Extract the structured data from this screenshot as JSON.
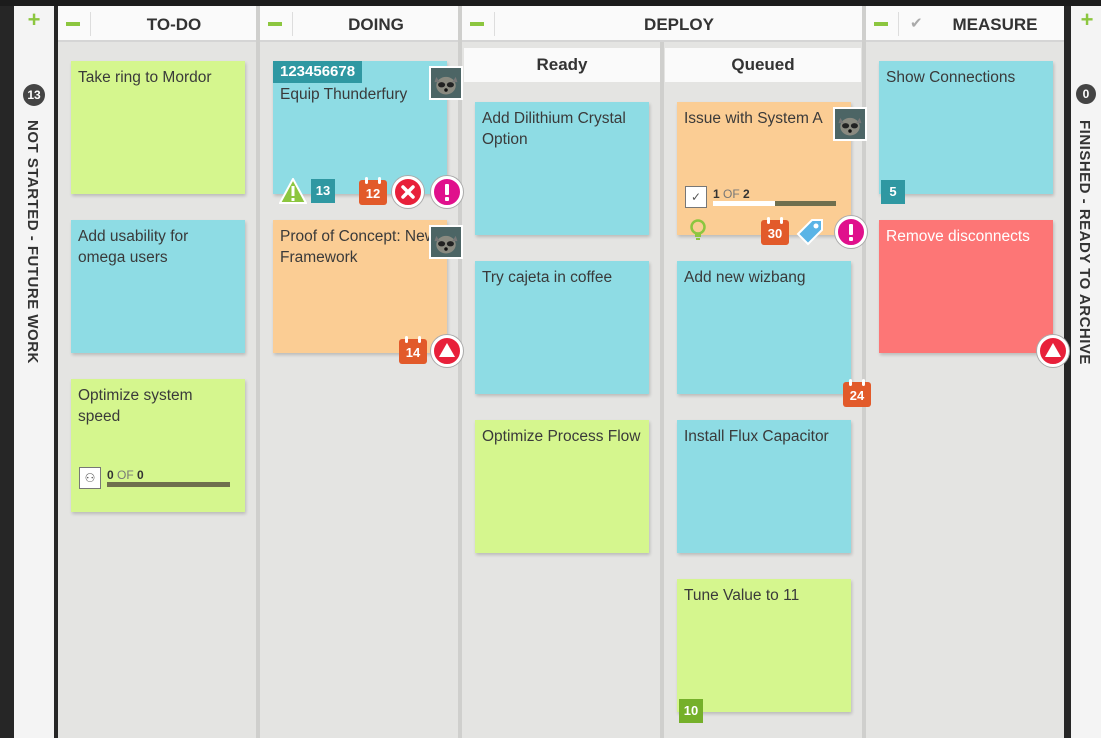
{
  "side_left": {
    "count": "13",
    "label": "NOT STARTED - FUTURE WORK"
  },
  "side_right": {
    "count": "0",
    "label": "FINISHED - READY TO ARCHIVE"
  },
  "columns": {
    "todo": {
      "title": "TO-DO"
    },
    "doing": {
      "title": "DOING"
    },
    "deploy": {
      "title": "DEPLOY",
      "sub_ready": "Ready",
      "sub_queued": "Queued"
    },
    "measure": {
      "title": "MEASURE"
    }
  },
  "cards": {
    "todo_1": {
      "title": "Take ring to Mordor",
      "color": "#d5f68e"
    },
    "todo_2": {
      "title": "Add usability for omega users",
      "color": "#8edce4"
    },
    "todo_3": {
      "title": "Optimize system speed",
      "color": "#d5f68e",
      "progress_done": "0",
      "progress_of": "OF",
      "progress_total": "0",
      "progress_fraction": 0
    },
    "doing_1": {
      "id": "123456678",
      "title": "Equip Thunderfury",
      "color": "#8edce4",
      "count": "13",
      "due": "12"
    },
    "doing_2": {
      "title": "Proof of Concept: New Framework",
      "color": "#fbcd94",
      "due": "14"
    },
    "ready_1": {
      "title": "Add Dilithium Crystal Option",
      "color": "#8edce4"
    },
    "ready_2": {
      "title": "Try cajeta in coffee",
      "color": "#8edce4"
    },
    "ready_3": {
      "title": "Optimize Process Flow",
      "color": "#d5f68e"
    },
    "queued_1": {
      "title": "Issue with System A",
      "color": "#fbcd94",
      "progress_done": "1",
      "progress_of": "OF",
      "progress_total": "2",
      "progress_fraction": 0.5,
      "due": "30"
    },
    "queued_2": {
      "title": "Add new wizbang",
      "color": "#8edce4",
      "due": "24"
    },
    "queued_3": {
      "title": "Install Flux Capacitor",
      "color": "#8edce4"
    },
    "queued_4": {
      "title": "Tune Value to 11",
      "color": "#d5f68e",
      "count": "10"
    },
    "measure_1": {
      "title": "Show Connections",
      "color": "#8edce4",
      "count": "5"
    },
    "measure_2": {
      "title": "Remove disconnects",
      "color": "#fd7676"
    }
  },
  "icons": {
    "plus": "+",
    "check": "✔",
    "progress_tree": "⚇",
    "progress_check": "✓"
  },
  "colors": {
    "accent_green": "#8cc63f",
    "teal": "#2f98a2",
    "calendar": "#e25a2a",
    "blocked": "#e8203a",
    "priority": "#e0108c"
  }
}
